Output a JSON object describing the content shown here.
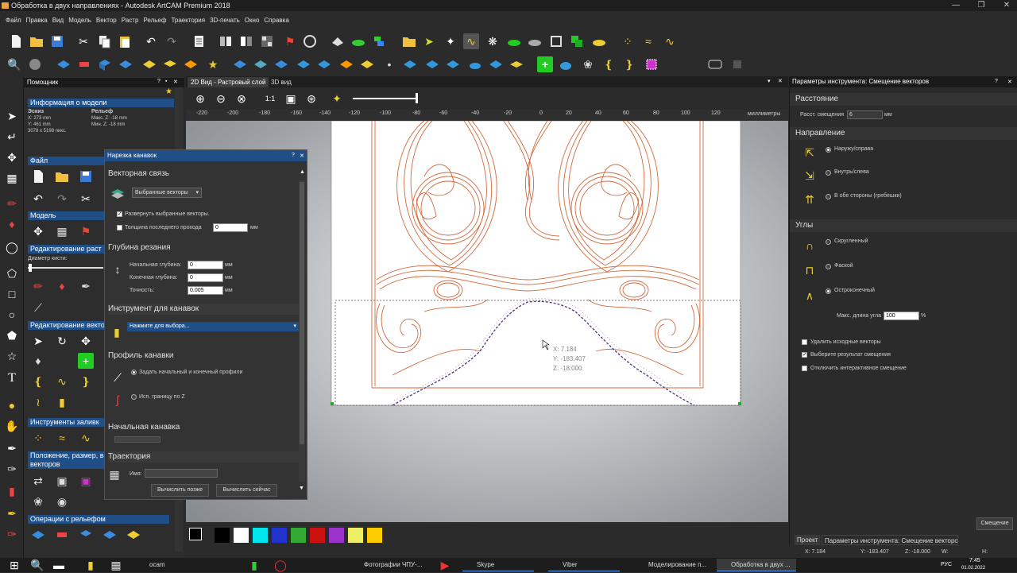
{
  "window": {
    "title": "Обработка в двух направлениях - Autodesk ArtCAM Premium 2018"
  },
  "menu": [
    "Файл",
    "Правка",
    "Вид",
    "Модель",
    "Вектор",
    "Растр",
    "Рельеф",
    "Траектория",
    "3D-печать",
    "Окно",
    "Справка"
  ],
  "assistant": {
    "title": "Помощник",
    "model_info": {
      "header": "Информация о модели",
      "sketch_label": "Эскиз",
      "relief_label": "Рельеф",
      "x": "X: 273 mm",
      "y": "Y: 461 mm",
      "pixels": "3078 x 5198 пикс.",
      "max_z": "Макс. Z: -18 mm",
      "min_z": "Мин. Z: -18 mm"
    },
    "sections": {
      "file": "Файл",
      "model": "Модель",
      "raster_edit": "Редактирование раст",
      "brush_diameter": "Диаметр кисти:",
      "vector_edit": "Редактирование векто",
      "fill_tools": "Инструменты заливк",
      "position": "Положение, размер, в",
      "position2": "векторов",
      "relief_ops": "Операции с рельефом"
    }
  },
  "groove_dialog": {
    "title": "Нарезка канавок",
    "vector_link": "Векторная связь",
    "vector_select": "Выбранные векторы",
    "expand_vectors": "Развернуть выбранные векторы.",
    "last_pass": "Толщина последнего прохода",
    "last_pass_value": "0",
    "unit_mm": "мм",
    "depth_header": "Глубина резания",
    "start_depth_label": "Начальная глубина:",
    "start_depth": "0",
    "end_depth_label": "Конечная глубина:",
    "end_depth": "0",
    "tolerance_label": "Точность:",
    "tolerance": "0.005",
    "tool_header": "Инструмент для канавок",
    "tool_select": "Нажмите для выбора...",
    "profile_header": "Профиль канавки",
    "profile_opt1": "Задать начальный и конечный профили",
    "profile_opt2": "Исп. границу по Z",
    "start_groove": "Начальная канавка",
    "trajectory": "Траектория",
    "name_label": "Имя:",
    "calc_later": "Вычислить позже",
    "calc_now": "Вычислить сейчас"
  },
  "view_tabs": {
    "tab2d": "2D Вид - Растровый слой",
    "tab3d": "3D вид"
  },
  "ruler": {
    "ticks": [
      "-220",
      "-200",
      "-180",
      "-160",
      "-140",
      "-120",
      "-100",
      "-80",
      "-60",
      "-40",
      "-20",
      "0",
      "20",
      "40",
      "60",
      "80",
      "100",
      "120"
    ],
    "unit": "миллиметры"
  },
  "cursor_readout": {
    "x": "X: 7.184",
    "y": "Y: -183.407",
    "z": "Z: -18.000"
  },
  "right_panel": {
    "title": "Параметры инструмента: Смещение векторов",
    "distance_header": "Расстояние",
    "offset_label": "Расст. смещения",
    "offset_value": "6",
    "unit": "мм",
    "direction_header": "Направление",
    "dir_out": "Наружу/справа",
    "dir_in": "Внутрь/слева",
    "dir_both": "В обе стороны (гребешки)",
    "corners_header": "Углы",
    "corner_round": "Скругленный",
    "corner_chamfer": "Фаской",
    "corner_sharp": "Остроконечный",
    "max_angle_label": "Макс. длина угла",
    "max_angle_value": "100",
    "percent": "%",
    "delete_src": "Удалить исходные векторы",
    "select_result": "Выберите результат смещения",
    "disable_interactive": "Отключить интерактивное смещение",
    "apply_button": "Смещение",
    "tab_project": "Проект",
    "tab_params": "Параметры инструмента: Смещение векторов"
  },
  "status": {
    "x": "X: 7.184",
    "y": "Y: -183.407",
    "z": "Z: -18.000",
    "w": "W:",
    "h": "H:"
  },
  "palette": [
    "#000000",
    "#ffffff",
    "#00e5ee",
    "#2233cc",
    "#33aa33",
    "#cc1111",
    "#9933cc",
    "#eeee66",
    "#ffcc00"
  ],
  "taskbar": {
    "items": [
      "ocam",
      "Фотографии ЧПУ-...",
      "Skype",
      "Viber",
      "Моделирование п...",
      "Обработка в двух ..."
    ],
    "lang": "РУС",
    "time": "7:45",
    "date": "01.02.2022"
  },
  "colors": {
    "accent": "#1f4f86",
    "vector_line": "#d2693c",
    "offset_line": "#5b3b8c"
  }
}
